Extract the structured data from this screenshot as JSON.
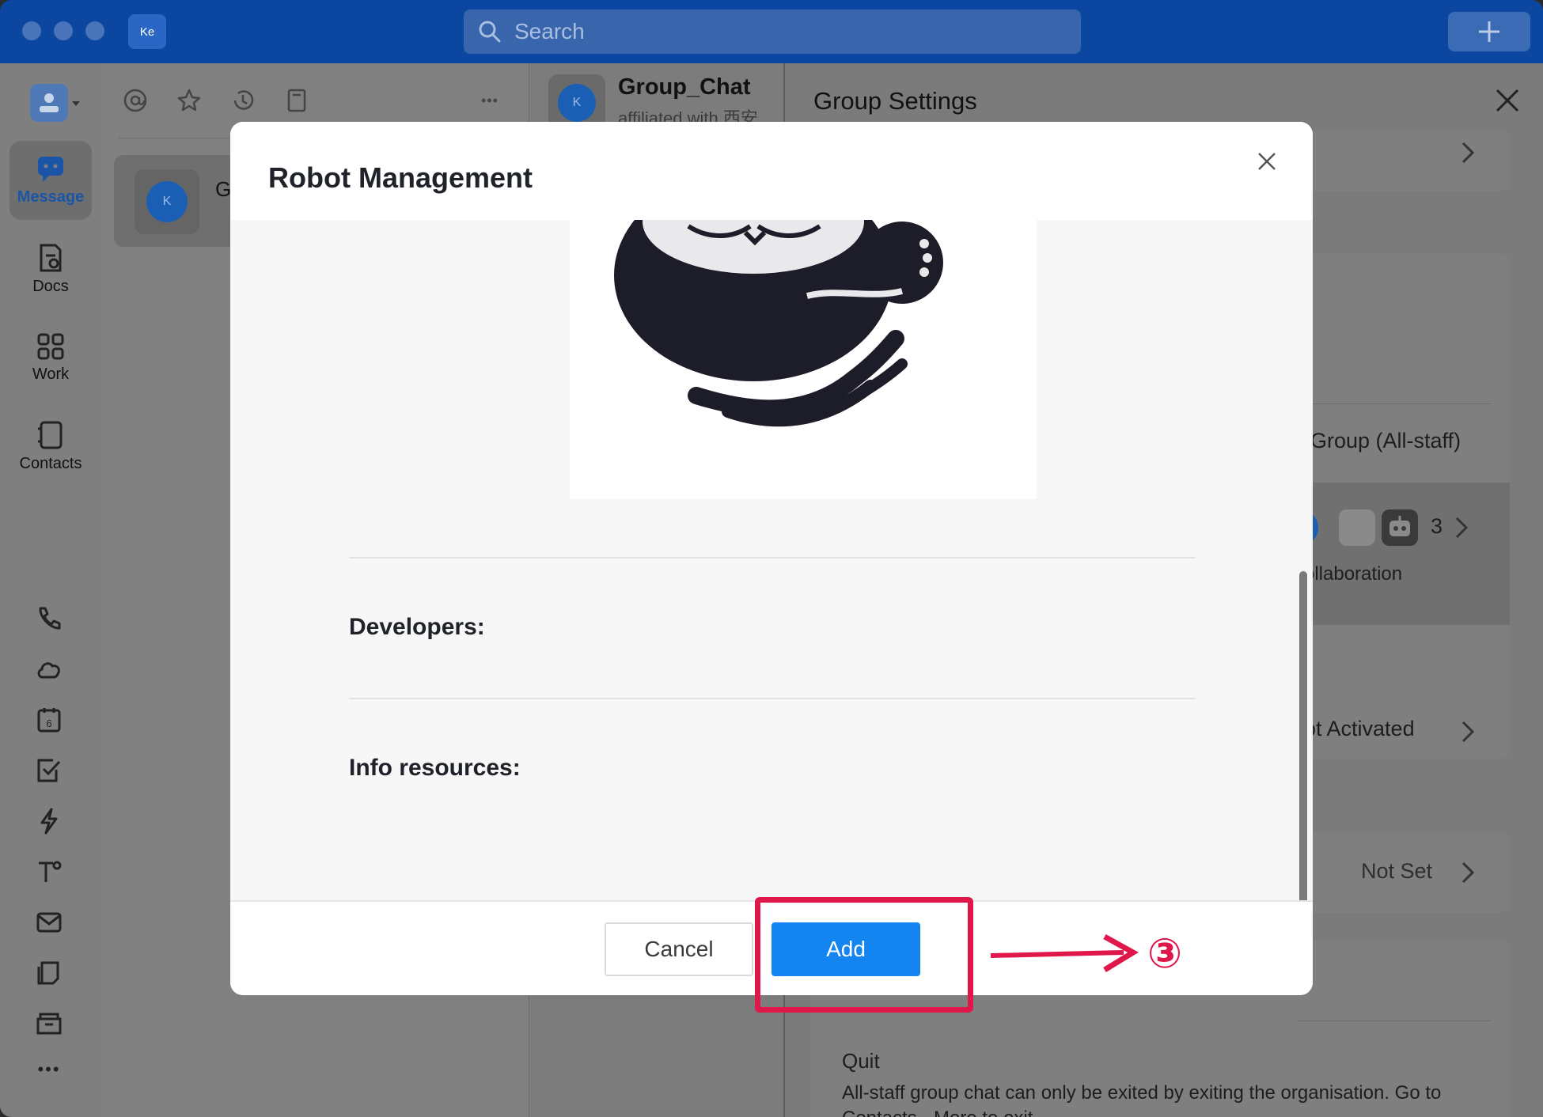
{
  "titlebar": {
    "workspace_badge": "Ke",
    "search_placeholder": "Search"
  },
  "rail": {
    "items": [
      {
        "label": "Message",
        "icon": "message-icon",
        "active": true
      },
      {
        "label": "Docs",
        "icon": "docs-icon"
      },
      {
        "label": "Work",
        "icon": "work-grid-icon"
      },
      {
        "label": "Contacts",
        "icon": "contacts-icon"
      }
    ],
    "tools": [
      "phone-icon",
      "cloud-icon",
      "calendar-icon",
      "task-check-icon",
      "lightning-icon",
      "approval-icon",
      "mail-icon",
      "notes-icon",
      "folder-icon",
      "more-icon"
    ],
    "calendar_day": "6",
    "more_glyph": "•••"
  },
  "chatlist": {
    "toolbar_icons": [
      "mention-icon",
      "star-icon",
      "history-icon",
      "bookmark-icon",
      "more-icon"
    ],
    "item": {
      "avatar_letter": "K",
      "name_partial": "G"
    }
  },
  "chat": {
    "avatar_letter": "K",
    "title": "Group_Chat",
    "subtitle": "affiliated with 西安"
  },
  "settings": {
    "title": "Group Settings",
    "group_type": "Group (All-staff)",
    "member_count": "3",
    "collab_text": "collaboration",
    "activation_status": "ot Activated",
    "not_set": "Not Set",
    "quit_label": "Quit",
    "quit_note": "All-staff group chat can only be exited by exiting the organisation. Go to Contacts - More to exit."
  },
  "modal": {
    "title": "Robot Management",
    "developers_label": "Developers:",
    "info_label": "Info resources:",
    "cancel_label": "Cancel",
    "add_label": "Add"
  },
  "annotation": {
    "step": "③",
    "color": "#e0174b"
  },
  "colors": {
    "titlebar": "#0b47a1",
    "primary_button": "#1384f0",
    "overlay_gray": "#7f7f7f"
  }
}
